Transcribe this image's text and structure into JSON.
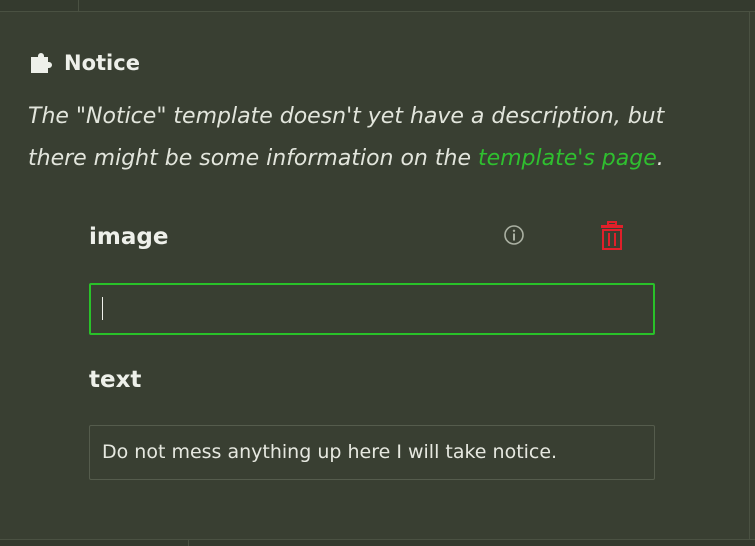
{
  "template": {
    "title": "Notice",
    "description_prefix": "The \"Notice\" template doesn't yet have a description, but there might be some information on the ",
    "description_link": "template's page",
    "description_suffix": "."
  },
  "params": {
    "image": {
      "label": "image",
      "value": ""
    },
    "text": {
      "label": "text",
      "value": "Do not mess anything up here I will take notice."
    }
  },
  "icons": {
    "header": "puzzle-piece-icon",
    "info": "info-icon",
    "remove": "trash-icon"
  },
  "colors": {
    "background": "#393f32",
    "link": "#2fbf2f",
    "focus_border": "#29c129",
    "delete": "#e0202a"
  }
}
